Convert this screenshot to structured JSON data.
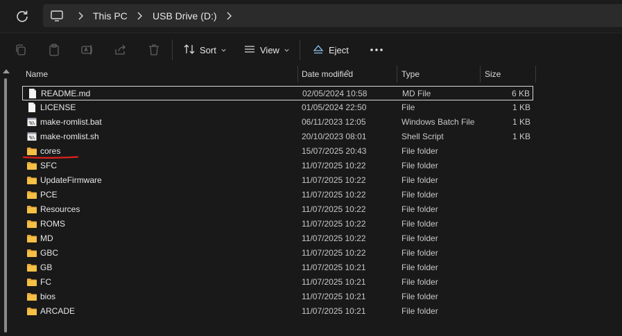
{
  "address_bar": {
    "crumbs": [
      "This PC",
      "USB Drive (D:)"
    ]
  },
  "toolbar": {
    "sort_label": "Sort",
    "view_label": "View",
    "eject_label": "Eject"
  },
  "columns": {
    "name": "Name",
    "date_modified": "Date modified",
    "type": "Type",
    "size": "Size"
  },
  "files": [
    {
      "name": "README.md",
      "date": "02/05/2024 10:58",
      "type": "MD File",
      "size": "6 KB",
      "icon": "document-icon"
    },
    {
      "name": "LICENSE",
      "date": "01/05/2024 22:50",
      "type": "File",
      "size": "1 KB",
      "icon": "document-icon"
    },
    {
      "name": "make-romlist.bat",
      "date": "06/11/2023 12:05",
      "type": "Windows Batch File",
      "size": "1 KB",
      "icon": "script-icon"
    },
    {
      "name": "make-romlist.sh",
      "date": "20/10/2023 08:01",
      "type": "Shell Script",
      "size": "1 KB",
      "icon": "script-icon"
    },
    {
      "name": "cores",
      "date": "15/07/2025 20:43",
      "type": "File folder",
      "size": "",
      "icon": "folder-icon"
    },
    {
      "name": "SFC",
      "date": "11/07/2025 10:22",
      "type": "File folder",
      "size": "",
      "icon": "folder-icon"
    },
    {
      "name": "UpdateFirmware",
      "date": "11/07/2025 10:22",
      "type": "File folder",
      "size": "",
      "icon": "folder-icon"
    },
    {
      "name": "PCE",
      "date": "11/07/2025 10:22",
      "type": "File folder",
      "size": "",
      "icon": "folder-icon"
    },
    {
      "name": "Resources",
      "date": "11/07/2025 10:22",
      "type": "File folder",
      "size": "",
      "icon": "folder-icon"
    },
    {
      "name": "ROMS",
      "date": "11/07/2025 10:22",
      "type": "File folder",
      "size": "",
      "icon": "folder-icon"
    },
    {
      "name": "MD",
      "date": "11/07/2025 10:22",
      "type": "File folder",
      "size": "",
      "icon": "folder-icon"
    },
    {
      "name": "GBC",
      "date": "11/07/2025 10:22",
      "type": "File folder",
      "size": "",
      "icon": "folder-icon"
    },
    {
      "name": "GB",
      "date": "11/07/2025 10:21",
      "type": "File folder",
      "size": "",
      "icon": "folder-icon"
    },
    {
      "name": "FC",
      "date": "11/07/2025 10:21",
      "type": "File folder",
      "size": "",
      "icon": "folder-icon"
    },
    {
      "name": "bios",
      "date": "11/07/2025 10:21",
      "type": "File folder",
      "size": "",
      "icon": "folder-icon"
    },
    {
      "name": "ARCADE",
      "date": "11/07/2025 10:21",
      "type": "File folder",
      "size": "",
      "icon": "folder-icon"
    }
  ],
  "colors": {
    "folder": "#f5c044",
    "background": "#191919",
    "annotation": "#e0201a"
  }
}
